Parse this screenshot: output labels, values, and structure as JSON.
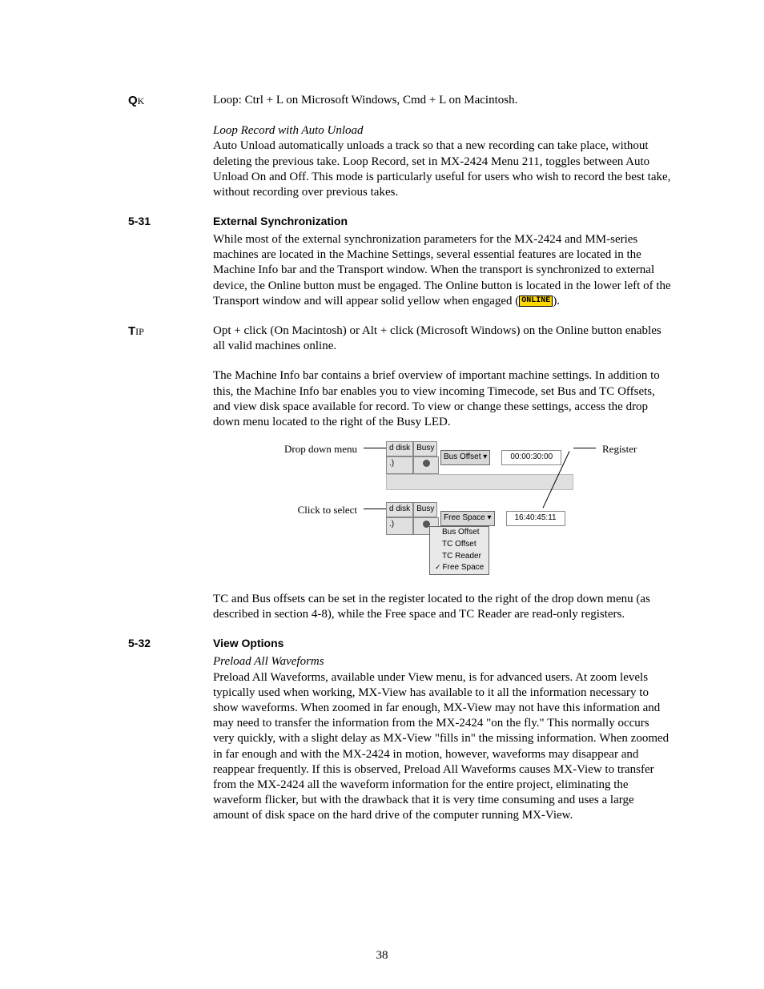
{
  "qk_label_big": "Q",
  "qk_label_small": "K",
  "qk_text": "Loop: Ctrl + L on Microsoft Windows, Cmd + L on Macintosh.",
  "loop_heading": "Loop Record with Auto Unload",
  "loop_body": "Auto Unload automatically unloads a track so that a new recording can take place, without deleting the previous take. Loop Record, set in MX-2424 Menu 211, toggles between Auto Unload On and Off. This mode is particularly useful for users who wish to record the best take, without recording over previous takes.",
  "sec_531_num": "5-31",
  "sec_531_title": "External Synchronization",
  "sec_531_body_pre": "While most of the external synchronization parameters for the MX-2424 and MM-series machines are located in the Machine Settings, several essential features are located in the Machine Info bar and the Transport window. When the transport is synchronized to external device, the Online button must be engaged. The Online button is located in the lower left of the Transport window and will appear solid yellow when engaged (",
  "online_badge": "ONLINE",
  "sec_531_body_post": ").",
  "tip_label_big": "T",
  "tip_label_small": "IP",
  "tip_text": "Opt + click (On Macintosh) or Alt + click (Microsoft Windows) on the Online button enables all valid machines online.",
  "machine_info_para": "The Machine Info bar contains a brief overview of important machine settings.  In addition to this, the Machine Info bar enables you to view incoming Timecode, set Bus and TC Offsets, and view disk space available for record. To view or change these settings, access the drop down menu located to the right of the Busy LED.",
  "fig": {
    "left_label_1": "Drop down menu",
    "left_label_2": "Click to select",
    "right_label": "Register",
    "disk_hdr": "d disk",
    "busy_hdr": "Busy",
    "bus_offset_btn": "Bus Offset ▾",
    "tc_value_1": "00:00:30:00",
    "free_space_btn": "Free Space ▾",
    "tc_value_2": "16:40:45:11",
    "menu_items": [
      "Bus Offset",
      "TC Offset",
      "TC Reader",
      "Free Space"
    ]
  },
  "after_fig_para": "TC and Bus offsets can be set in the register located to the right of the drop down menu (as described in section 4-8), while the Free space and TC Reader are read-only registers.",
  "sec_532_num": "5-32",
  "sec_532_title": "View Options",
  "preload_heading": "Preload All Waveforms",
  "preload_body": "Preload All Waveforms, available under View menu, is for advanced users.  At zoom levels typically used when working, MX-View has available to it all the information necessary to show waveforms.  When zoomed in far enough, MX-View may not have this information and may need to transfer the information from the MX-2424 \"on the fly.\"  This normally occurs very quickly, with a slight delay as MX-View \"fills in\" the missing information.  When zoomed in far enough and with the MX-2424 in motion, however, waveforms may disappear and reappear frequently.  If this is observed, Preload All Waveforms causes MX-View to transfer from the MX-2424 all the waveform information for the entire project, eliminating the waveform flicker, but with the drawback that it is very time consuming and uses a large amount of disk space on the hard drive of the computer running MX-View.",
  "page_number": "38"
}
